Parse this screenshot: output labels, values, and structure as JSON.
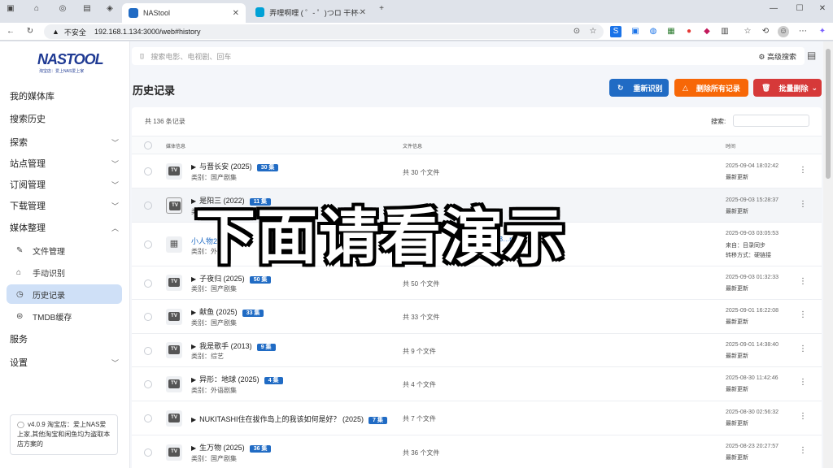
{
  "browser": {
    "tabs": [
      {
        "label": "NAStool",
        "active": true
      },
      {
        "label": "弄哩啊哩 ( ゜- ゜)つロ 干杯~-bilibili",
        "active": false
      }
    ],
    "url_security": "不安全",
    "url": "192.168.1.134:3000/web#history"
  },
  "sidebar": {
    "logo": "NASTOOL",
    "logo_sub": "淘宝店：爱上NAS爱上家",
    "items": [
      {
        "label": "我的媒体库"
      },
      {
        "label": "搜索历史"
      },
      {
        "label": "探索"
      },
      {
        "label": "站点管理"
      },
      {
        "label": "订阅管理"
      },
      {
        "label": "下载管理"
      },
      {
        "label": "媒体整理"
      }
    ],
    "subitems": [
      {
        "label": "文件管理",
        "icon": "file-icon"
      },
      {
        "label": "手动识别",
        "icon": "tag-icon"
      },
      {
        "label": "历史记录",
        "icon": "history-icon",
        "active": true
      },
      {
        "label": "TMDB缓存",
        "icon": "database-icon"
      }
    ],
    "items2": [
      {
        "label": "服务"
      },
      {
        "label": "设置"
      }
    ],
    "footer": "v4.0.9 淘宝店：爱上NAS爱上家,其他淘宝和闲鱼均为盗取本店方案的"
  },
  "main": {
    "search_placeholder": "搜索电影、电视剧、回车",
    "advanced_search": "高级搜索",
    "page_title": "历史记录",
    "buttons": {
      "reidentify": "重新识别",
      "delete_all": "删除所有记录",
      "batch_delete": "批量删除"
    },
    "colors": {
      "reidentify": "#206bc4",
      "delete_all": "#f76707",
      "batch_delete": "#d63939"
    },
    "record_count": "共 136 条记录",
    "search_label": "搜索:",
    "columns": {
      "media": "媒体信息",
      "file": "文件信息",
      "time": "时间"
    },
    "rows": [
      {
        "title": "与晋长安 (2025)",
        "badge": "30 集",
        "cat": "类别：国产剧集",
        "file": "共 30 个文件",
        "time": "2025-09-04 18:02:42",
        "status": "最新更新"
      },
      {
        "title": "是阳三 (2022)",
        "badge": "11 集",
        "cat": "类别：",
        "file": "",
        "time": "2025-09-03 15:28:37",
        "status": "最新更新"
      },
      {
        "title": "小人物2 (2",
        "badge": "",
        "cat": "类别：外语",
        "file": "…WEB…mkv",
        "time": "2025-09-03 03:05:53",
        "status": "来自：目录同步",
        "status2": "转移方式：硬链接"
      },
      {
        "title": "子夜归 (2025)",
        "badge": "50 集",
        "cat": "类别：国产剧集",
        "file": "共 50 个文件",
        "time": "2025-09-03 01:32:33",
        "status": "最新更新"
      },
      {
        "title": "献鱼 (2025)",
        "badge": "33 集",
        "cat": "类别：国产剧集",
        "file": "共 33 个文件",
        "time": "2025-09-01 16:22:08",
        "status": "最新更新"
      },
      {
        "title": "我是歌手 (2013)",
        "badge": "9 集",
        "cat": "类别：综艺",
        "file": "共 9 个文件",
        "time": "2025-09-01 14:38:40",
        "status": "最新更新"
      },
      {
        "title": "异形：地球 (2025)",
        "badge": "4 集",
        "cat": "类别：外语剧集",
        "file": "共 4 个文件",
        "time": "2025-08-30 11:42:46",
        "status": "最新更新"
      },
      {
        "title": "NUKITASHI住在拔作岛上的我该如何是好？ (2025)",
        "badge": "7 集",
        "cat": "",
        "file": "共 7 个文件",
        "time": "2025-08-30 02:56:32",
        "status": "最新更新"
      },
      {
        "title": "生万物 (2025)",
        "badge": "36 集",
        "cat": "类别：国产剧集",
        "file": "共 36 个文件",
        "time": "2025-08-23 20:27:57",
        "status": "最新更新"
      }
    ]
  },
  "overlay_caption": "下面请看演示"
}
